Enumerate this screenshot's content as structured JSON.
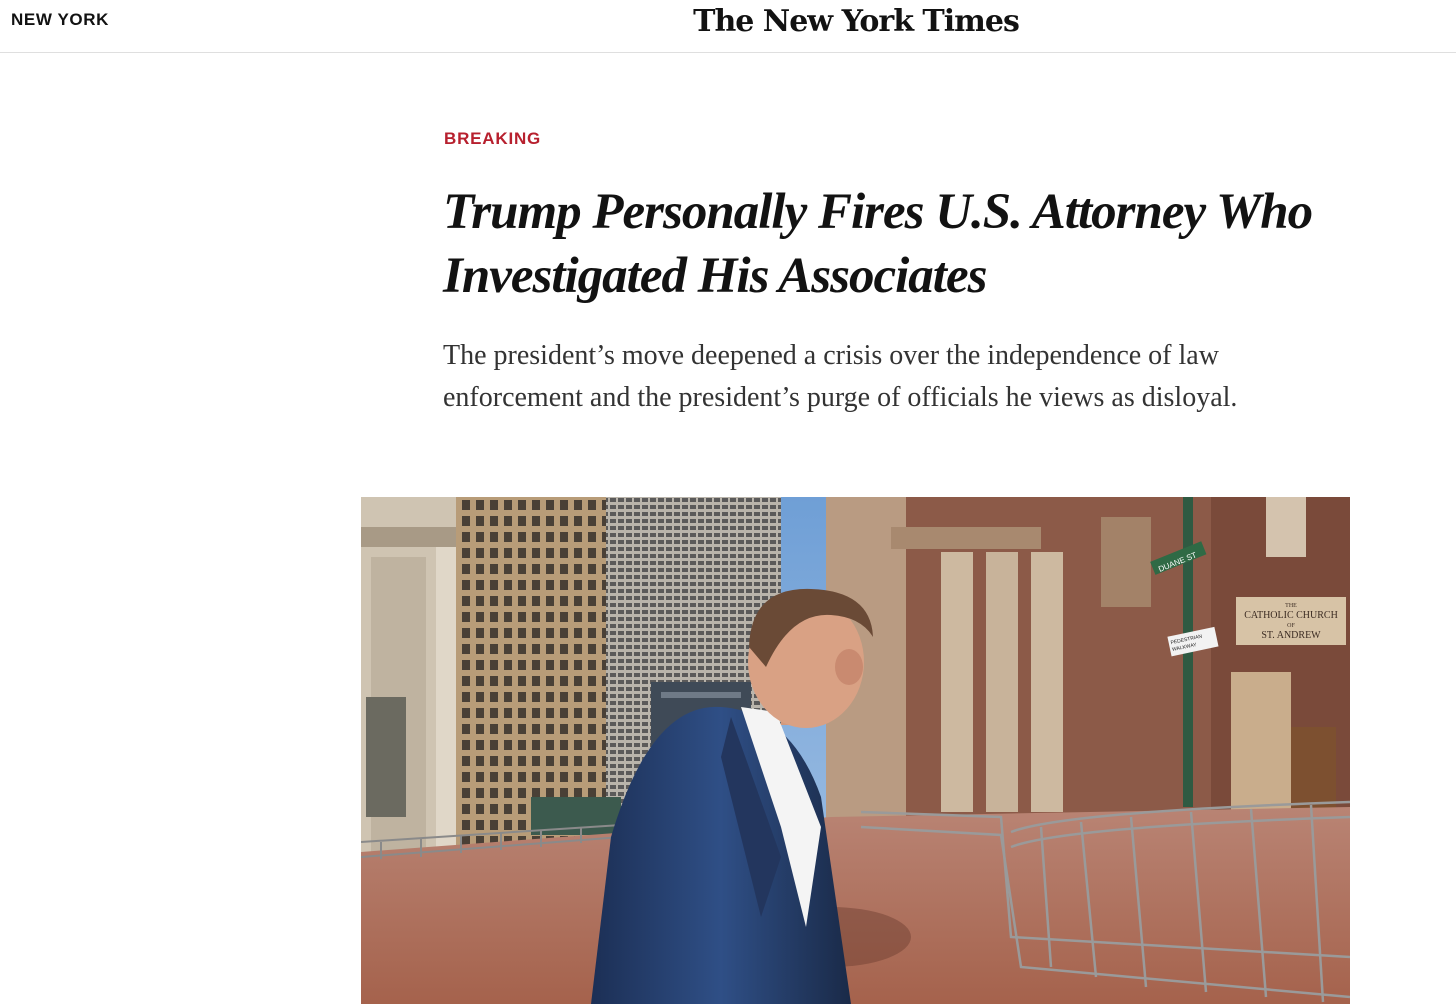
{
  "header": {
    "section": "NEW YORK",
    "masthead": "The New York Times"
  },
  "article": {
    "kicker": "BREAKING",
    "headline": "Trump Personally Fires U.S. Attorney Who Investigated His Associates",
    "summary": "The president’s move deepened a crisis over the independence of law enforcement and the president’s purge of officials he views as disloyal."
  },
  "photo": {
    "signs": {
      "street": "DUANE ST",
      "church_line1": "THE",
      "church_line2": "CATHOLIC CHURCH",
      "church_line3": "OF",
      "church_line4": "ST. ANDREW",
      "pedestrian_line1": "PEDESTRIAN",
      "pedestrian_line2": "WALKWAY"
    }
  },
  "colors": {
    "kicker": "#b7202e",
    "text": "#121212",
    "summary": "#333333",
    "divider": "#dfdfdf"
  }
}
